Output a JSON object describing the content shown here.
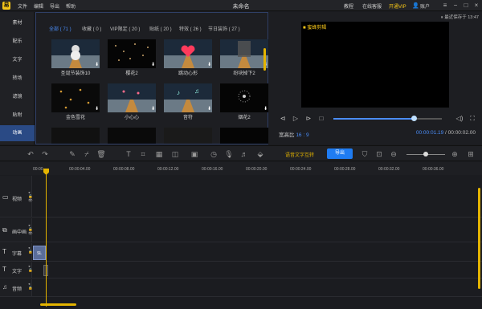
{
  "titlebar": {
    "logo": "易",
    "menu": [
      "文件",
      "编辑",
      "导出",
      "帮助"
    ],
    "title": "未命名",
    "right": {
      "tutorial": "教程",
      "online": "在线客服",
      "vip": "开通VIP",
      "account": "账户"
    }
  },
  "nav": [
    "素材",
    "配乐",
    "文字",
    "转场",
    "滤镜",
    "贴附",
    "动画"
  ],
  "media": {
    "tabs": [
      "全部 ( 71 )",
      "收藏 ( 0 )",
      "VIP限定 ( 20 )",
      "贴纸 ( 20 )",
      "特效 ( 26 )",
      "节日装饰 ( 27 )"
    ],
    "items": [
      {
        "label": "圣诞节装饰10",
        "icon": "snowman-thumbnail"
      },
      {
        "label": "樱花2",
        "icon": "petals-thumbnail"
      },
      {
        "label": "跳动心形",
        "icon": "heart-thumbnail"
      },
      {
        "label": "纷块掉下2",
        "icon": "falling-blocks-thumbnail"
      },
      {
        "label": "金色雪花",
        "icon": "gold-snow-thumbnail"
      },
      {
        "label": "小心心",
        "icon": "small-hearts-thumbnail"
      },
      {
        "label": "音符",
        "icon": "notes-thumbnail"
      },
      {
        "label": "烟花2",
        "icon": "fireworks-thumbnail"
      }
    ]
  },
  "preview": {
    "watermark": "■ 蜜蜂剪辑",
    "clock": "⏸ 最近保存于 13:47",
    "ratio_label": "宽高比",
    "ratio_value": "16 : 9",
    "time_current": "00:00:01.19",
    "time_total": " / 00:00:02.00",
    "progress": 0.74
  },
  "toolbar": {
    "speech": "语音文字互转",
    "export": "导出",
    "zoom": 0.5
  },
  "timeline": {
    "ticks": [
      "00:00",
      "00:00:04.00",
      "00:00:08.00",
      "00:00:12.00",
      "00:00:16.00",
      "00:00:20.00",
      "00:00:24.00",
      "00:00:28.00",
      "00:00:32.00",
      "00:00:36.00"
    ],
    "tracks": [
      {
        "name": "视频",
        "icon": "video-track-icon"
      },
      {
        "name": "画中画",
        "icon": "pip-track-icon"
      },
      {
        "name": "字幕",
        "icon": "subtitle-track-icon"
      },
      {
        "name": "文字",
        "icon": "text-track-icon"
      },
      {
        "name": "音频",
        "icon": "audio-track-icon"
      }
    ],
    "clip_label": "SL"
  }
}
